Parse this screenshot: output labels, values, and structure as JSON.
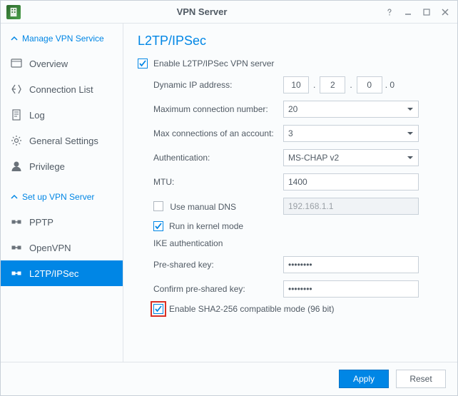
{
  "window": {
    "title": "VPN Server"
  },
  "sidebar": {
    "section1": {
      "header": "Manage VPN Service",
      "items": [
        {
          "label": "Overview"
        },
        {
          "label": "Connection List"
        },
        {
          "label": "Log"
        },
        {
          "label": "General Settings"
        },
        {
          "label": "Privilege"
        }
      ]
    },
    "section2": {
      "header": "Set up VPN Server",
      "items": [
        {
          "label": "PPTP"
        },
        {
          "label": "OpenVPN"
        },
        {
          "label": "L2TP/IPSec"
        }
      ]
    }
  },
  "page": {
    "title": "L2TP/IPSec",
    "enable_label": "Enable L2TP/IPSec VPN server",
    "rows": {
      "dyn_ip_label": "Dynamic IP address:",
      "dyn_ip_oct1": "10",
      "dyn_ip_oct2": "2",
      "dyn_ip_oct3": "0",
      "dyn_ip_suffix": ". 0",
      "max_conn_label": "Maximum connection number:",
      "max_conn_value": "20",
      "max_acct_label": "Max connections of an account:",
      "max_acct_value": "3",
      "auth_label": "Authentication:",
      "auth_value": "MS-CHAP v2",
      "mtu_label": "MTU:",
      "mtu_value": "1400",
      "manual_dns_label": "Use manual DNS",
      "manual_dns_value": "192.168.1.1",
      "kernel_label": "Run in kernel mode",
      "ike_heading": "IKE authentication",
      "psk_label": "Pre-shared key:",
      "psk_value": "········",
      "psk2_label": "Confirm pre-shared key:",
      "psk2_value": "········",
      "sha_label": "Enable SHA2-256 compatible mode (96 bit)"
    }
  },
  "footer": {
    "apply": "Apply",
    "reset": "Reset"
  }
}
